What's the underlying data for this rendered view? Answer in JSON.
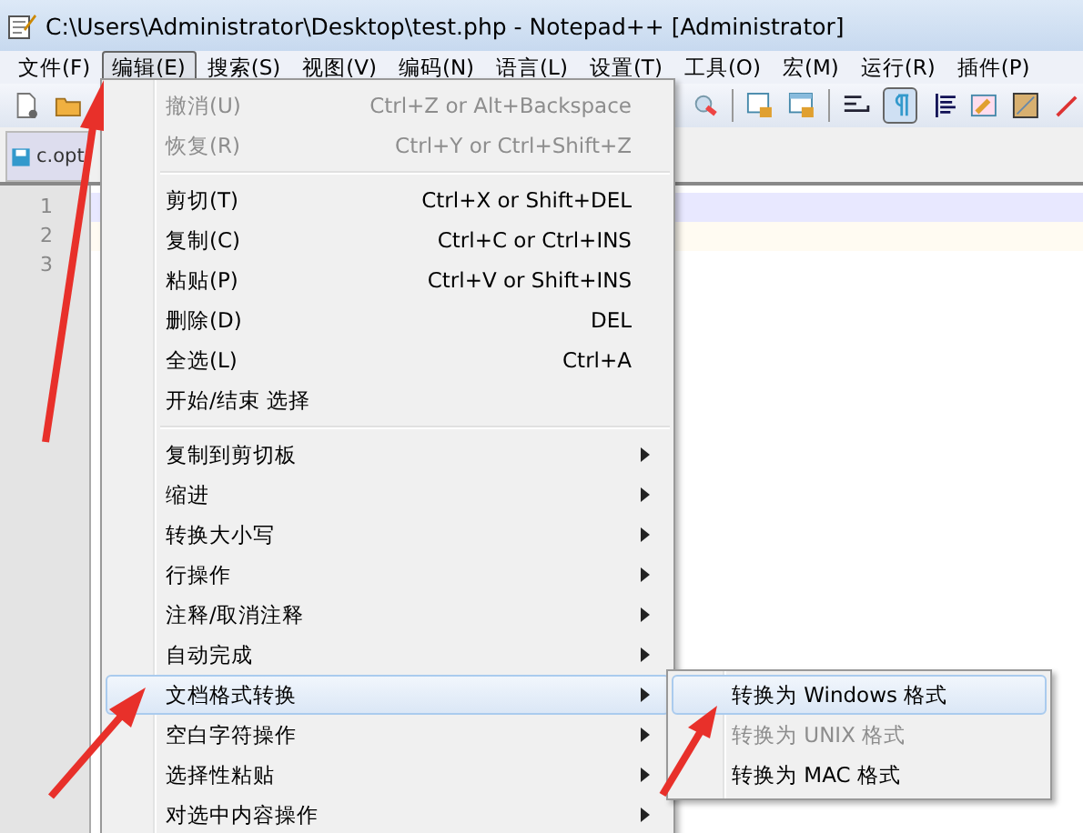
{
  "window": {
    "title": "C:\\Users\\Administrator\\Desktop\\test.php - Notepad++ [Administrator]"
  },
  "menu_bar": [
    {
      "label": "文件(F)",
      "selected": false
    },
    {
      "label": "编辑(E)",
      "selected": true
    },
    {
      "label": "搜索(S)",
      "selected": false
    },
    {
      "label": "视图(V)",
      "selected": false
    },
    {
      "label": "编码(N)",
      "selected": false
    },
    {
      "label": "语言(L)",
      "selected": false
    },
    {
      "label": "设置(T)",
      "selected": false
    },
    {
      "label": "工具(O)",
      "selected": false
    },
    {
      "label": "宏(M)",
      "selected": false
    },
    {
      "label": "运行(R)",
      "selected": false
    },
    {
      "label": "插件(P)",
      "selected": false
    }
  ],
  "tab": {
    "label": "c.opt"
  },
  "line_numbers": [
    "1",
    "2",
    "3"
  ],
  "edit_menu": [
    {
      "kind": "item",
      "label": "撤消(U)",
      "shortcut": "Ctrl+Z or Alt+Backspace",
      "disabled": true,
      "submenu": false,
      "selected": false
    },
    {
      "kind": "item",
      "label": "恢复(R)",
      "shortcut": "Ctrl+Y or Ctrl+Shift+Z",
      "disabled": true,
      "submenu": false,
      "selected": false
    },
    {
      "kind": "separator"
    },
    {
      "kind": "item",
      "label": "剪切(T)",
      "shortcut": "Ctrl+X or Shift+DEL",
      "disabled": false,
      "submenu": false,
      "selected": false
    },
    {
      "kind": "item",
      "label": "复制(C)",
      "shortcut": "Ctrl+C or Ctrl+INS",
      "disabled": false,
      "submenu": false,
      "selected": false
    },
    {
      "kind": "item",
      "label": "粘贴(P)",
      "shortcut": "Ctrl+V or Shift+INS",
      "disabled": false,
      "submenu": false,
      "selected": false
    },
    {
      "kind": "item",
      "label": "删除(D)",
      "shortcut": "DEL",
      "disabled": false,
      "submenu": false,
      "selected": false
    },
    {
      "kind": "item",
      "label": "全选(L)",
      "shortcut": "Ctrl+A",
      "disabled": false,
      "submenu": false,
      "selected": false
    },
    {
      "kind": "item",
      "label": "开始/结束 选择",
      "disabled": false,
      "submenu": false,
      "selected": false
    },
    {
      "kind": "separator"
    },
    {
      "kind": "item",
      "label": "复制到剪切板",
      "disabled": false,
      "submenu": true,
      "selected": false
    },
    {
      "kind": "item",
      "label": "缩进",
      "disabled": false,
      "submenu": true,
      "selected": false
    },
    {
      "kind": "item",
      "label": "转换大小写",
      "disabled": false,
      "submenu": true,
      "selected": false
    },
    {
      "kind": "item",
      "label": "行操作",
      "disabled": false,
      "submenu": true,
      "selected": false
    },
    {
      "kind": "item",
      "label": "注释/取消注释",
      "disabled": false,
      "submenu": true,
      "selected": false
    },
    {
      "kind": "item",
      "label": "自动完成",
      "disabled": false,
      "submenu": true,
      "selected": false
    },
    {
      "kind": "item",
      "label": "文档格式转换",
      "disabled": false,
      "submenu": true,
      "selected": true
    },
    {
      "kind": "item",
      "label": "空白字符操作",
      "disabled": false,
      "submenu": true,
      "selected": false
    },
    {
      "kind": "item",
      "label": "选择性粘贴",
      "disabled": false,
      "submenu": true,
      "selected": false
    },
    {
      "kind": "item",
      "label": "对选中内容操作",
      "disabled": false,
      "submenu": true,
      "selected": false
    }
  ],
  "submenu": [
    {
      "label": "转换为 Windows 格式",
      "disabled": false,
      "selected": true
    },
    {
      "label": "转换为 UNIX 格式",
      "disabled": true,
      "selected": false
    },
    {
      "label": "转换为 MAC 格式",
      "disabled": false,
      "selected": false
    }
  ]
}
